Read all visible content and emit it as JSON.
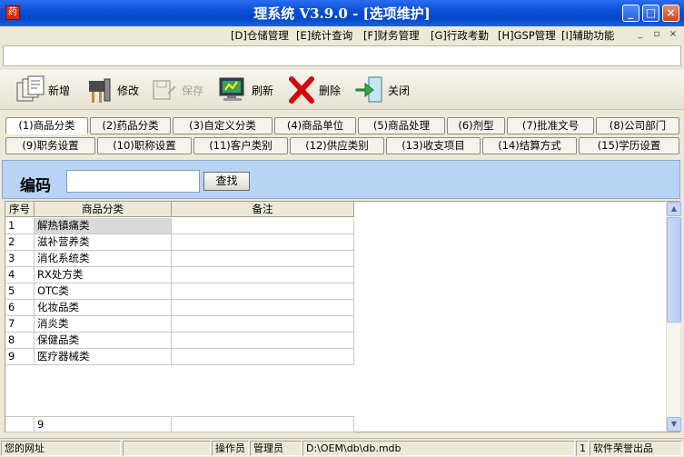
{
  "window": {
    "title": "理系统 V3.9.0 - [选项维护]",
    "app_icon": "药",
    "minimize": "_",
    "maximize": "□",
    "close": "×"
  },
  "menu": {
    "items": [
      "[D]仓储管理",
      "[E]统计查询",
      "[F]财务管理",
      "[G]行政考勤",
      "[H]GSP管理",
      "[I]辅助功能"
    ],
    "mdi_controls": [
      "_",
      "▫",
      "×"
    ]
  },
  "toolbar": {
    "new": "新增",
    "edit": "修改",
    "save": "保存",
    "refresh": "刷新",
    "delete": "删除",
    "close": "关闭"
  },
  "tabs": {
    "row1": [
      "(1)商品分类",
      "(2)药品分类",
      "(3)自定义分类",
      "(4)商品单位",
      "(5)商品处理",
      "(6)剂型",
      "(7)批准文号",
      "(8)公司部门"
    ],
    "row2": [
      "(9)职务设置",
      "(10)职称设置",
      "(11)客户类别",
      "(12)供应类别",
      "(13)收支项目",
      "(14)结算方式",
      "(15)学历设置"
    ],
    "active": "(1)商品分类"
  },
  "search": {
    "label": "编码",
    "value": "",
    "button": "查找"
  },
  "grid": {
    "headers": [
      "序号",
      "商品分类",
      "备注"
    ],
    "rows": [
      [
        "1",
        "解热镇痛类",
        ""
      ],
      [
        "2",
        "滋补营养类",
        ""
      ],
      [
        "3",
        "消化系统类",
        ""
      ],
      [
        "4",
        "RX处方类",
        ""
      ],
      [
        "5",
        "OTC类",
        ""
      ],
      [
        "6",
        "化妆品类",
        ""
      ],
      [
        "7",
        "消炎类",
        ""
      ],
      [
        "8",
        "保健品类",
        ""
      ],
      [
        "9",
        "医疗器械类",
        ""
      ]
    ],
    "selected_row": 0,
    "footer_count": "9"
  },
  "statusbar": {
    "website": "您的网址",
    "operator_label": "操作员",
    "operator": "管理员",
    "db_path": "D:\\OEM\\db\\db.mdb",
    "page": "1",
    "credit": "软件荣誉出品"
  }
}
